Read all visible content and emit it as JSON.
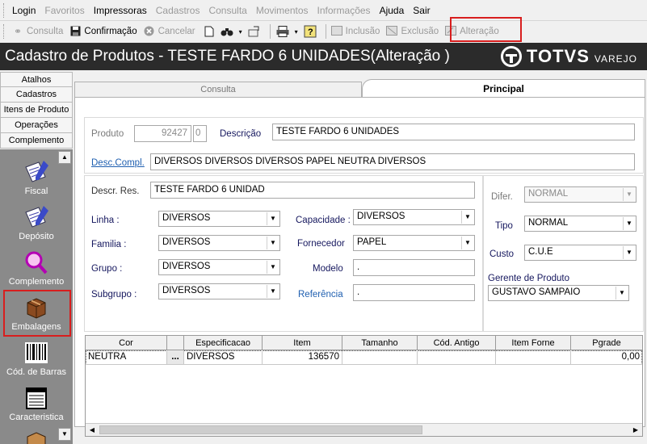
{
  "menu": [
    {
      "label": "Login",
      "enabled": true
    },
    {
      "label": "Favoritos",
      "enabled": false
    },
    {
      "label": "Impressoras",
      "enabled": true
    },
    {
      "label": "Cadastros",
      "enabled": false
    },
    {
      "label": "Consulta",
      "enabled": false
    },
    {
      "label": "Movimentos",
      "enabled": false
    },
    {
      "label": "Informações",
      "enabled": false
    },
    {
      "label": "Ajuda",
      "enabled": true
    },
    {
      "label": "Sair",
      "enabled": true
    }
  ],
  "toolbar": {
    "consulta": "Consulta",
    "confirmacao": "Confirmação",
    "cancelar": "Cancelar",
    "inclusao": "Inclusão",
    "exclusao": "Exclusão",
    "alteracao": "Alteração"
  },
  "title": "Cadastro de Produtos  - TESTE FARDO 6 UNIDADES(Alteração )",
  "brand": {
    "name": "TOTVS",
    "sub": "VAREJO"
  },
  "nav_tabs": [
    "Atalhos",
    "Cadastros",
    "Itens de Produto",
    "Operações",
    "Complemento"
  ],
  "sidebar": [
    "Fiscal",
    "Depósito",
    "Complemento",
    "Embalagens",
    "Cód. de Barras",
    "Caracteristica"
  ],
  "tabs": {
    "consulta": "Consulta",
    "principal": "Principal"
  },
  "form": {
    "produto_label": "Produto",
    "produto_value": "92427",
    "produto_digit": "0",
    "descricao_label": "Descrição",
    "descricao_value": "TESTE FARDO 6 UNIDADES",
    "desc_compl_label": "Desc.Compl.",
    "desc_compl_value": "DIVERSOS DIVERSOS DIVERSOS PAPEL NEUTRA DIVERSOS",
    "descr_res_label": "Descr. Res.",
    "descr_res_value": "TESTE FARDO 6 UNIDAD",
    "linha_label": "Linha :",
    "linha_value": "DIVERSOS",
    "familia_label": "Familia :",
    "familia_value": "DIVERSOS",
    "grupo_label": "Grupo :",
    "grupo_value": "DIVERSOS",
    "subgrupo_label": "Subgrupo :",
    "subgrupo_value": "DIVERSOS",
    "capacidade_label": "Capacidade :",
    "capacidade_value": "DIVERSOS",
    "fornecedor_label": "Fornecedor",
    "fornecedor_value": "PAPEL",
    "modelo_label": "Modelo",
    "modelo_value": ".",
    "referencia_label": "Referência",
    "referencia_value": ".",
    "difer_label": "Difer.",
    "difer_value": "NORMAL",
    "tipo_label": "Tipo",
    "tipo_value": "NORMAL",
    "custo_label": "Custo",
    "custo_value": "C.U.E",
    "gerente_label": "Gerente de Produto",
    "gerente_value": "GUSTAVO SAMPAIO"
  },
  "grid": {
    "columns": [
      "Cor",
      "",
      "Especificacao",
      "Item",
      "Tamanho",
      "Cód. Antigo",
      "Item Forne",
      "Pgrade"
    ],
    "rows": [
      [
        "NEUTRA",
        "...",
        "DIVERSOS",
        "136570",
        "",
        "",
        "",
        "0,00"
      ]
    ]
  },
  "colors": {
    "titlebar": "#2b2b2b",
    "sidebar": "#8a8a8a",
    "highlight": "#d81e1e"
  }
}
